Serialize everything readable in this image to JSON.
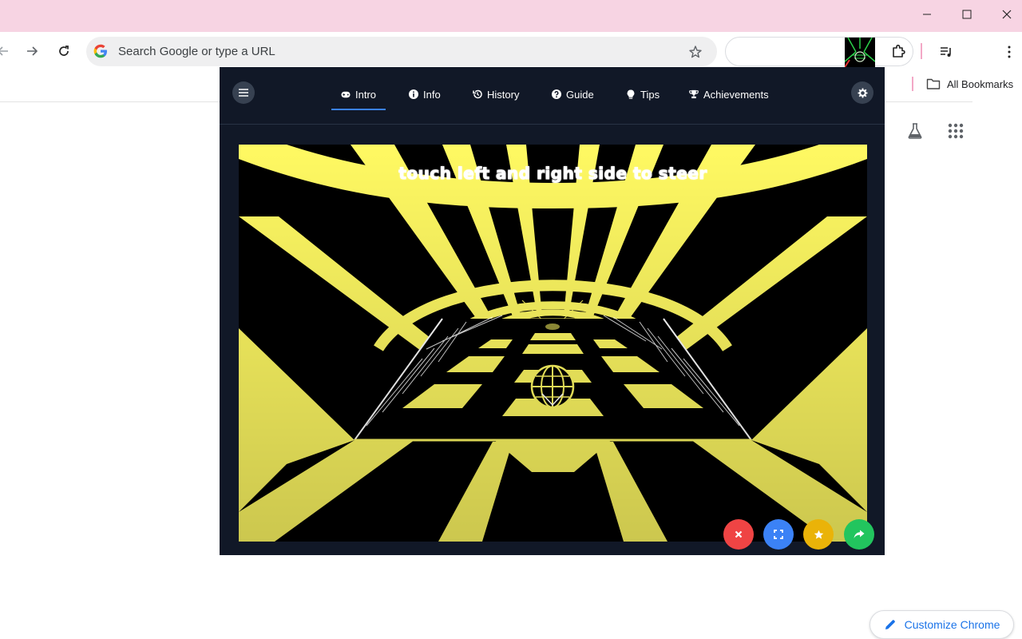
{
  "browser": {
    "omnibox": {
      "placeholder": "Search Google or type a URL",
      "logo_icon": "google-g-icon"
    },
    "bookmarks": {
      "all_bookmarks_label": "All Bookmarks"
    },
    "customize_label": "Customize Chrome"
  },
  "panel": {
    "tabs": [
      {
        "label": "Intro",
        "icon": "gamepad-icon",
        "active": true
      },
      {
        "label": "Info",
        "icon": "info-icon",
        "active": false
      },
      {
        "label": "History",
        "icon": "history-icon",
        "active": false
      },
      {
        "label": "Guide",
        "icon": "question-icon",
        "active": false
      },
      {
        "label": "Tips",
        "icon": "lightbulb-icon",
        "active": false
      },
      {
        "label": "Achievements",
        "icon": "trophy-icon",
        "active": false
      }
    ],
    "accent_color": "#3b82f6",
    "game": {
      "overlay_text": "touch left and right side to steer",
      "tunnel_color": "#fff962"
    },
    "actions": [
      {
        "name": "close",
        "color": "#ef4444"
      },
      {
        "name": "fullscreen",
        "color": "#3b82f6"
      },
      {
        "name": "favorite",
        "color": "#eab308"
      },
      {
        "name": "share",
        "color": "#22c55e"
      }
    ]
  }
}
